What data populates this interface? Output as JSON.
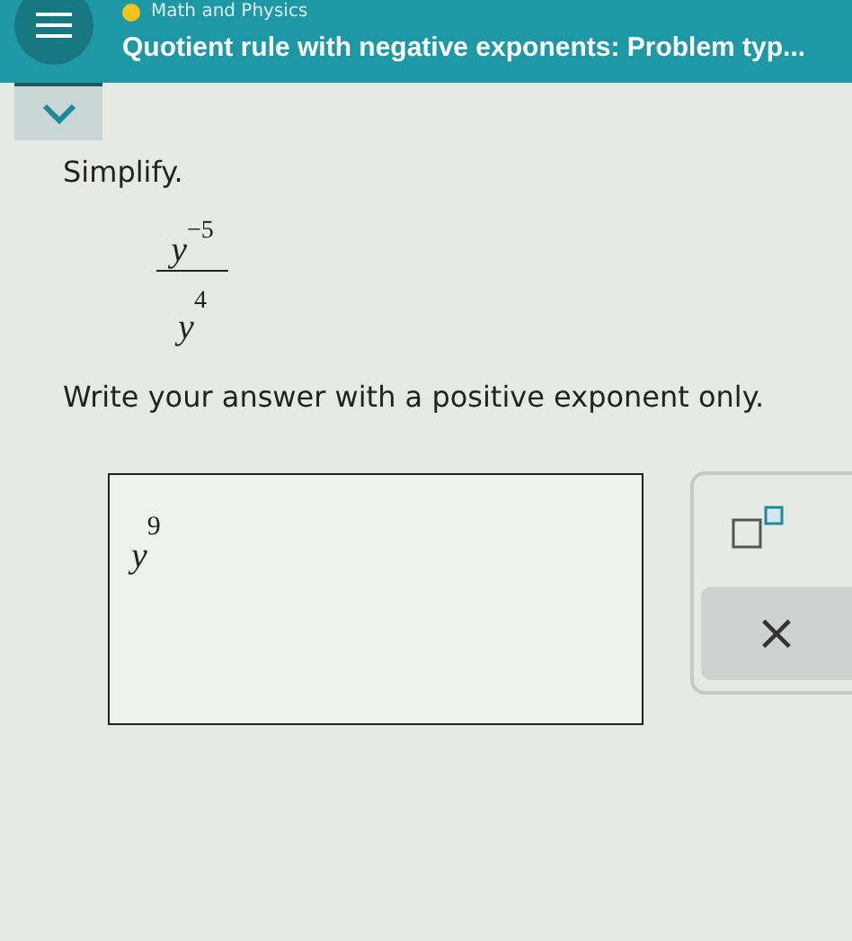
{
  "header": {
    "subject": "Math and Physics",
    "title": "Quotient rule with negative exponents: Problem typ..."
  },
  "toggle": {
    "expanded": false
  },
  "prompt": "Simplify.",
  "expression": {
    "numerator": {
      "base": "y",
      "exponent": "−5"
    },
    "denominator": {
      "base": "y",
      "exponent": "4"
    }
  },
  "instruction": "Write your answer with a positive exponent only.",
  "answer": {
    "base": "y",
    "exponent": "9"
  },
  "tools": [
    {
      "kind": "superscript"
    },
    {
      "kind": "clear",
      "label": "×"
    }
  ]
}
